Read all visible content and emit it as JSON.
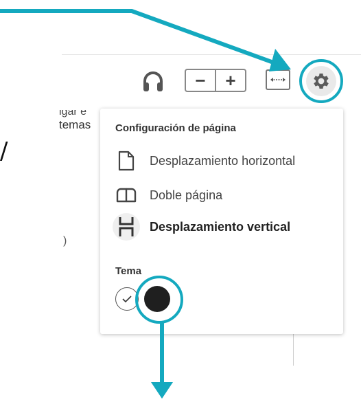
{
  "page_fragments": {
    "line1": "igar e",
    "line2": "temas",
    "slash": "/",
    "paren": ")"
  },
  "toolbar": {
    "audio_icon": "headphones-icon",
    "zoom_out_label": "−",
    "zoom_in_label": "+",
    "fit_icon": "fit-width-icon",
    "settings_icon": "gear-icon"
  },
  "settings_panel": {
    "page_config_heading": "Configuración de página",
    "options": [
      {
        "label": "Desplazamiento horizontal",
        "icon": "single-page-icon",
        "selected": false
      },
      {
        "label": "Doble página",
        "icon": "double-page-icon",
        "selected": false
      },
      {
        "label": "Desplazamiento vertical",
        "icon": "vertical-scroll-icon",
        "selected": true
      }
    ],
    "theme_heading": "Tema",
    "themes": [
      {
        "name": "light",
        "color": "#ffffff",
        "selected": true
      },
      {
        "name": "dark",
        "color": "#1f1f1f",
        "selected": false
      }
    ]
  },
  "annotation_color": "#14a9bf"
}
